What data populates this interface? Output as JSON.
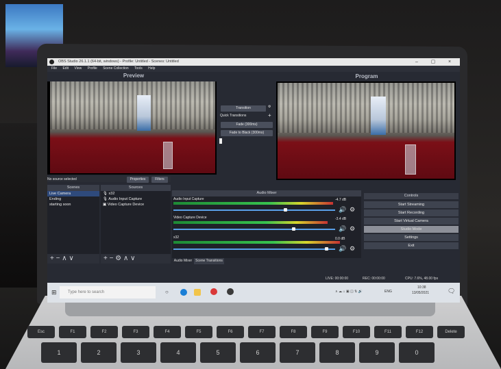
{
  "window": {
    "title": "OBS Studio 26.1.1 (64-bit, windows) - Profile: Untitled - Scenes: Untitled",
    "menu": [
      "File",
      "Edit",
      "View",
      "Profile",
      "Scene Collection",
      "Tools",
      "Help"
    ]
  },
  "studio": {
    "preview_label": "Preview",
    "program_label": "Program",
    "transition_button": "Transition",
    "quick_transitions_label": "Quick Transitions",
    "fade_button": "Fade (300ms)",
    "fade_black_button": "Fade to Black (300ms)",
    "no_source_selected": "No source selected",
    "properties_button": "Properties",
    "filters_button": "Filters"
  },
  "scenes": {
    "title": "Scenes",
    "items": [
      "Live Camera",
      "Ending",
      "starting soon"
    ]
  },
  "sources": {
    "title": "Sources",
    "items": [
      "x32",
      "Audio Input Capture",
      "Video Capture Device"
    ]
  },
  "mixer": {
    "title": "Audio Mixer",
    "channels": [
      {
        "name": "Audio Input Capture",
        "db": "-4.7 dB",
        "level": 0.93,
        "fader": 0.7
      },
      {
        "name": "Video Capture Device",
        "db": "-3.4 dB",
        "level": 0.9,
        "fader": 0.75
      },
      {
        "name": "x32",
        "db": "0.0 dB",
        "level": 0.97,
        "fader": 0.96
      }
    ],
    "tabs": [
      "Audio Mixer",
      "Scene Transitions"
    ]
  },
  "controls": {
    "title": "Controls",
    "buttons": [
      "Start Streaming",
      "Start Recording",
      "Start Virtual Camera",
      "Studio Mode",
      "Settings",
      "Exit"
    ]
  },
  "status": {
    "live": "LIVE: 00:00:00",
    "rec": "REC: 00:00:00",
    "cpu": "CPU: 7.6%, 48.00 fps"
  },
  "taskbar": {
    "search_placeholder": "Type here to search",
    "lang": "ENG",
    "time": "10:38",
    "date": "13/05/2021"
  },
  "keyboard": {
    "row1": [
      "Esc",
      "F1",
      "F2",
      "F3",
      "F4",
      "F5",
      "F6",
      "F7",
      "F8",
      "F9",
      "F10",
      "F11",
      "F12",
      "Delete"
    ],
    "row2": [
      "1",
      "2",
      "3",
      "4",
      "5",
      "6",
      "7",
      "8",
      "9",
      "0"
    ]
  }
}
